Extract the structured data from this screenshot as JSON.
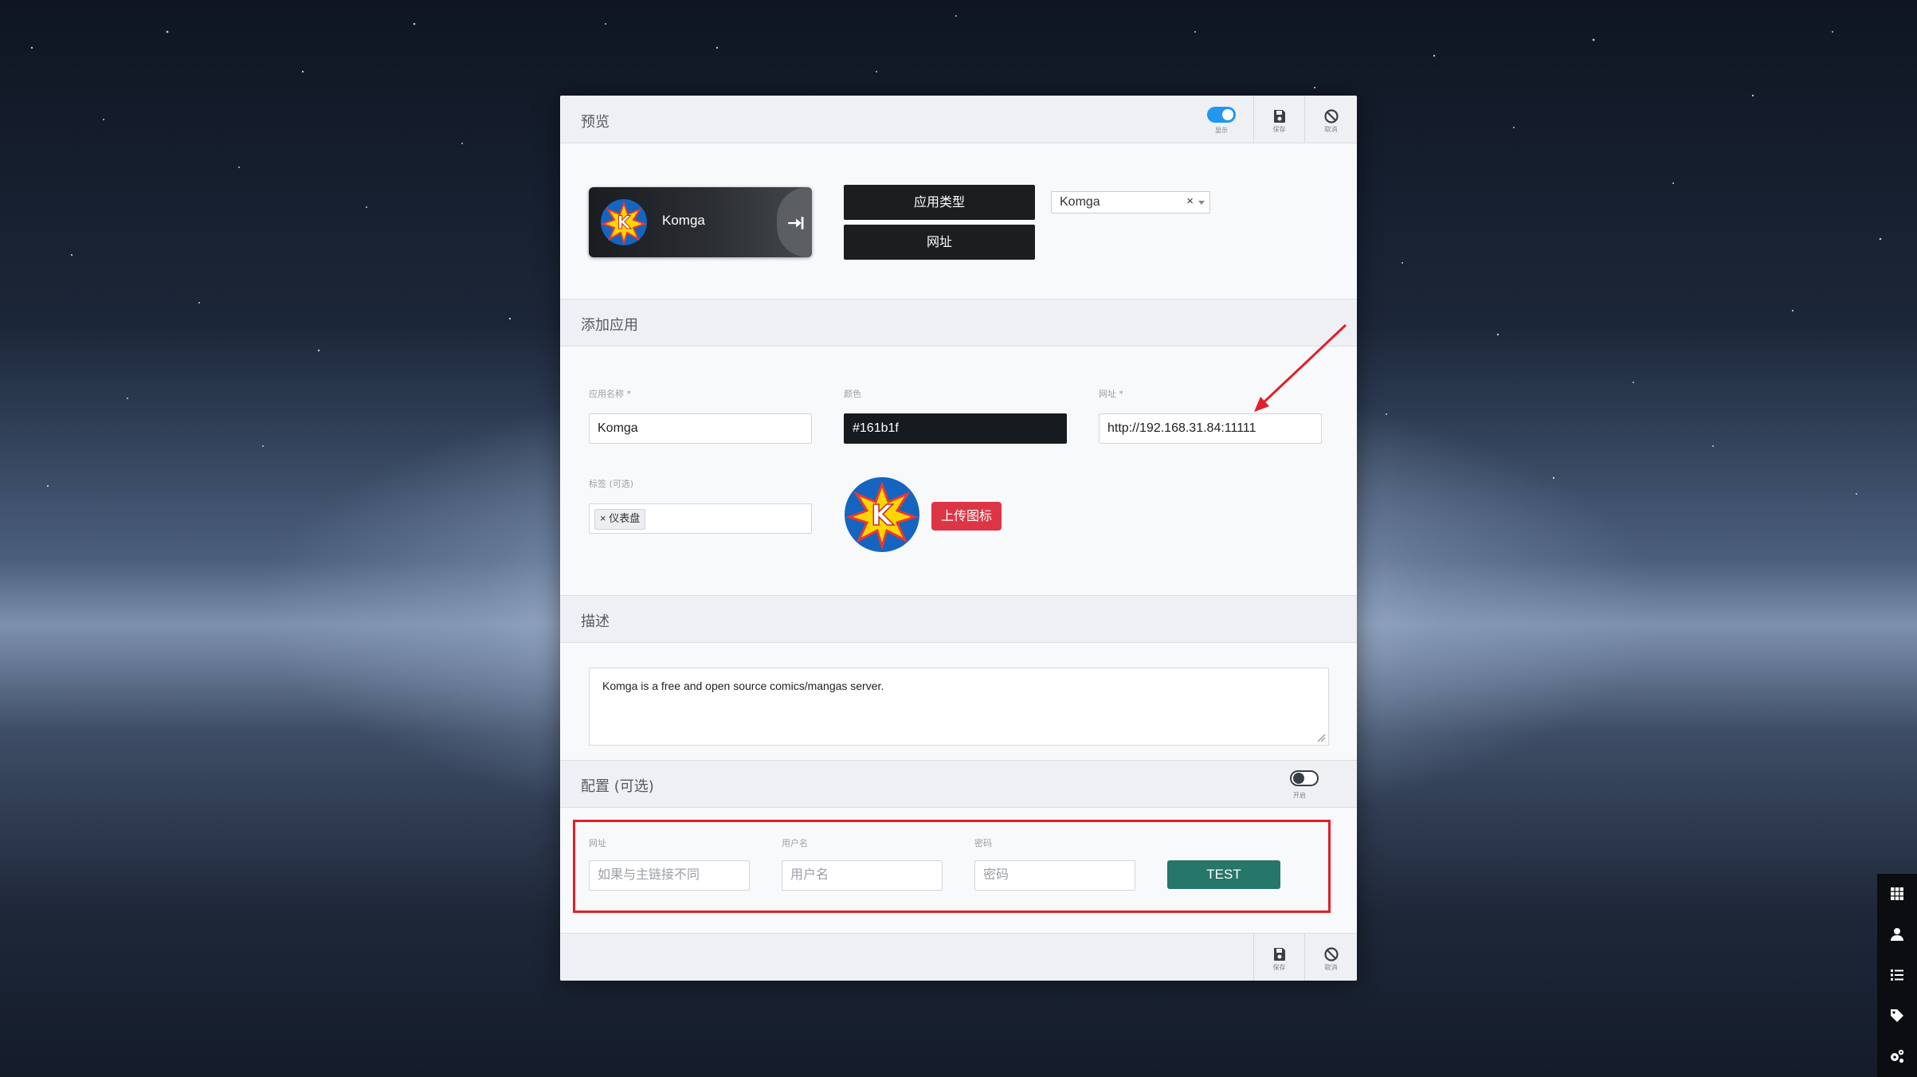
{
  "modal": {
    "preview": {
      "title": "预览",
      "toggle_caption": "显示",
      "save_caption": "保存",
      "cancel_caption": "取消",
      "tile": {
        "name": "Komga"
      },
      "app_type_label": "应用类型",
      "url_label": "网址",
      "select_value": "Komga",
      "select_clear": "×"
    },
    "add_app": {
      "title": "添加应用",
      "name_label": "应用名称 *",
      "name_value": "Komga",
      "color_label": "颜色",
      "color_value": "#161b1f",
      "url_label": "网址 *",
      "url_value": "http://192.168.31.84:11111",
      "tags_label": "标签 (可选)",
      "tag_chip": "× 仪表盘",
      "upload_label": "上传图标"
    },
    "description": {
      "title": "描述",
      "text": "Komga is a free and open source comics/mangas server."
    },
    "config": {
      "title": "配置 (可选)",
      "toggle_caption": "开启",
      "url_label": "网址",
      "url_placeholder": "如果与主链接不同",
      "username_label": "用户名",
      "username_placeholder": "用户名",
      "password_label": "密码",
      "password_placeholder": "密码",
      "test_label": "TEST"
    },
    "footer": {
      "save_caption": "保存",
      "cancel_caption": "取消"
    }
  },
  "dock": {
    "items": [
      "grid-icon",
      "user-icon",
      "list-icon",
      "tag-icon",
      "cogs-icon"
    ]
  },
  "colors": {
    "accent_blue": "#2196f3",
    "danger": "#dc3545",
    "teal": "#26766a",
    "annotation_red": "#e0202a"
  }
}
